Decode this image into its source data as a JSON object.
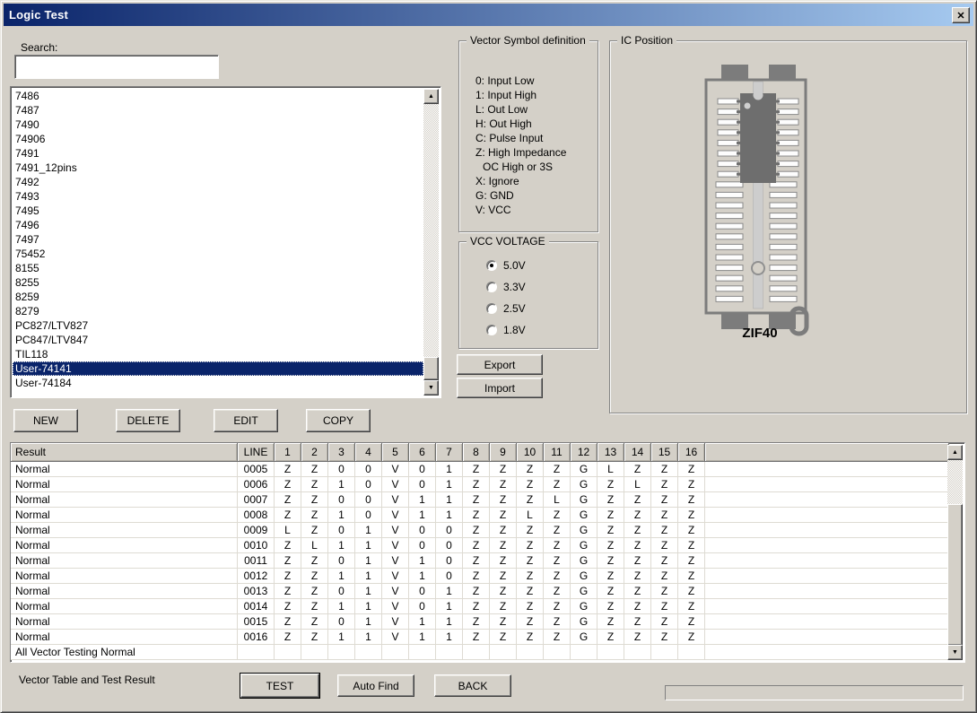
{
  "window": {
    "title": "Logic Test",
    "close_glyph": "✕"
  },
  "colors": {
    "dialog_bg": "#d4d0c8",
    "titlebar_left": "#0a246a",
    "titlebar_right": "#a6caf0",
    "selection": "#0a246a",
    "socket_gray": "#7c7c7c",
    "chip_gray": "#6e6e6e"
  },
  "search": {
    "label": "Search:",
    "value": "",
    "placeholder": ""
  },
  "ic_list": {
    "items": [
      "7486",
      "7487",
      "7490",
      "74906",
      "7491",
      "7491_12pins",
      "7492",
      "7493",
      "7495",
      "7496",
      "7497",
      "75452",
      "8155",
      "8255",
      "8259",
      "8279",
      "PC827/LTV827",
      "PC847/LTV847",
      "TIL118",
      "User-74141",
      "User-74184"
    ],
    "selected": "User-74141"
  },
  "list_buttons": {
    "new": "NEW",
    "delete": "DELETE",
    "edit": "EDIT",
    "copy": "COPY"
  },
  "vector_symbols": {
    "title": "Vector Symbol definition",
    "lines": [
      "0: Input Low",
      "1: Input High",
      "L: Out Low",
      "H: Out High",
      "C: Pulse Input",
      "Z: High Impedance",
      "OC High or 3S",
      "X: Ignore",
      "G: GND",
      "V: VCC"
    ]
  },
  "vcc_voltage": {
    "title": "VCC VOLTAGE",
    "options": [
      {
        "label": "5.0V",
        "selected": true
      },
      {
        "label": "3.3V",
        "selected": false
      },
      {
        "label": "2.5V",
        "selected": false
      },
      {
        "label": "1.8V",
        "selected": false
      }
    ]
  },
  "io_buttons": {
    "export": "Export",
    "import": "Import"
  },
  "ic_position": {
    "title": "IC Position",
    "socket_label": "ZIF40"
  },
  "result_table": {
    "columns": [
      "Result",
      "LINE",
      "1",
      "2",
      "3",
      "4",
      "5",
      "6",
      "7",
      "8",
      "9",
      "10",
      "11",
      "12",
      "13",
      "14",
      "15",
      "16"
    ],
    "rows": [
      {
        "result": "Normal",
        "line": "0005",
        "pins": [
          "Z",
          "Z",
          "0",
          "0",
          "V",
          "0",
          "1",
          "Z",
          "Z",
          "Z",
          "Z",
          "G",
          "L",
          "Z",
          "Z",
          "Z"
        ]
      },
      {
        "result": "Normal",
        "line": "0006",
        "pins": [
          "Z",
          "Z",
          "1",
          "0",
          "V",
          "0",
          "1",
          "Z",
          "Z",
          "Z",
          "Z",
          "G",
          "Z",
          "L",
          "Z",
          "Z"
        ]
      },
      {
        "result": "Normal",
        "line": "0007",
        "pins": [
          "Z",
          "Z",
          "0",
          "0",
          "V",
          "1",
          "1",
          "Z",
          "Z",
          "Z",
          "L",
          "G",
          "Z",
          "Z",
          "Z",
          "Z"
        ]
      },
      {
        "result": "Normal",
        "line": "0008",
        "pins": [
          "Z",
          "Z",
          "1",
          "0",
          "V",
          "1",
          "1",
          "Z",
          "Z",
          "L",
          "Z",
          "G",
          "Z",
          "Z",
          "Z",
          "Z"
        ]
      },
      {
        "result": "Normal",
        "line": "0009",
        "pins": [
          "L",
          "Z",
          "0",
          "1",
          "V",
          "0",
          "0",
          "Z",
          "Z",
          "Z",
          "Z",
          "G",
          "Z",
          "Z",
          "Z",
          "Z"
        ]
      },
      {
        "result": "Normal",
        "line": "0010",
        "pins": [
          "Z",
          "L",
          "1",
          "1",
          "V",
          "0",
          "0",
          "Z",
          "Z",
          "Z",
          "Z",
          "G",
          "Z",
          "Z",
          "Z",
          "Z"
        ]
      },
      {
        "result": "Normal",
        "line": "0011",
        "pins": [
          "Z",
          "Z",
          "0",
          "1",
          "V",
          "1",
          "0",
          "Z",
          "Z",
          "Z",
          "Z",
          "G",
          "Z",
          "Z",
          "Z",
          "Z"
        ]
      },
      {
        "result": "Normal",
        "line": "0012",
        "pins": [
          "Z",
          "Z",
          "1",
          "1",
          "V",
          "1",
          "0",
          "Z",
          "Z",
          "Z",
          "Z",
          "G",
          "Z",
          "Z",
          "Z",
          "Z"
        ]
      },
      {
        "result": "Normal",
        "line": "0013",
        "pins": [
          "Z",
          "Z",
          "0",
          "1",
          "V",
          "0",
          "1",
          "Z",
          "Z",
          "Z",
          "Z",
          "G",
          "Z",
          "Z",
          "Z",
          "Z"
        ]
      },
      {
        "result": "Normal",
        "line": "0014",
        "pins": [
          "Z",
          "Z",
          "1",
          "1",
          "V",
          "0",
          "1",
          "Z",
          "Z",
          "Z",
          "Z",
          "G",
          "Z",
          "Z",
          "Z",
          "Z"
        ]
      },
      {
        "result": "Normal",
        "line": "0015",
        "pins": [
          "Z",
          "Z",
          "0",
          "1",
          "V",
          "1",
          "1",
          "Z",
          "Z",
          "Z",
          "Z",
          "G",
          "Z",
          "Z",
          "Z",
          "Z"
        ]
      },
      {
        "result": "Normal",
        "line": "0016",
        "pins": [
          "Z",
          "Z",
          "1",
          "1",
          "V",
          "1",
          "1",
          "Z",
          "Z",
          "Z",
          "Z",
          "G",
          "Z",
          "Z",
          "Z",
          "Z"
        ]
      }
    ],
    "footer": "All Vector Testing Normal"
  },
  "bottom": {
    "label": "Vector Table and Test Result",
    "test": "TEST",
    "auto_find": "Auto Find",
    "back": "BACK"
  }
}
